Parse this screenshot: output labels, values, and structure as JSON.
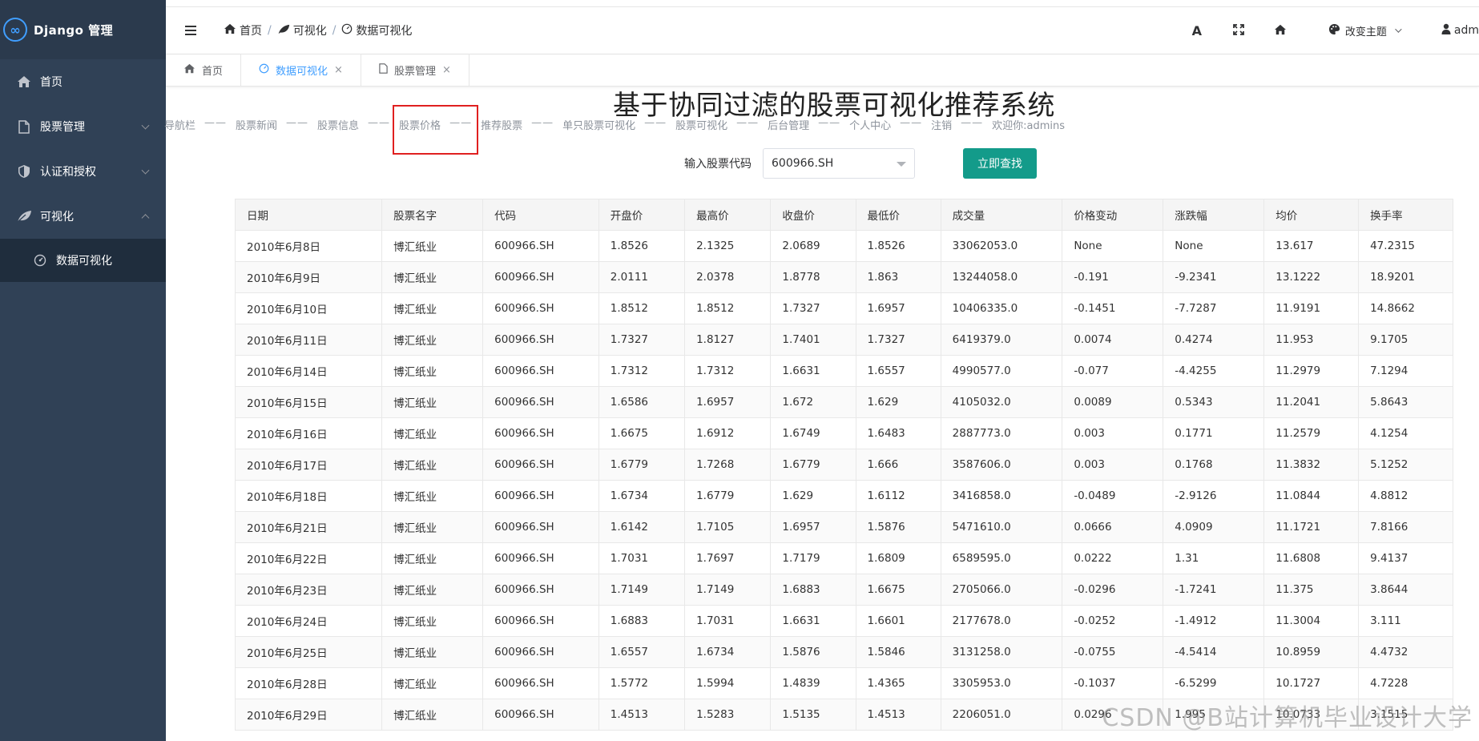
{
  "app": {
    "logo_glyph": "∞",
    "title": "Django 管理"
  },
  "sidebar": {
    "items": [
      {
        "label": "首页",
        "icon": "home-icon"
      },
      {
        "label": "股票管理",
        "icon": "document-icon"
      },
      {
        "label": "认证和授权",
        "icon": "shield-icon"
      },
      {
        "label": "可视化",
        "icon": "leaf-icon"
      }
    ],
    "submenu": [
      {
        "label": "数据可视化",
        "icon": "dashboard-icon"
      }
    ]
  },
  "breadcrumb": [
    "首页",
    "可视化",
    "数据可视化"
  ],
  "navbar": {
    "theme_label": "改变主题",
    "user_label": "adm"
  },
  "tags": [
    {
      "label": "首页",
      "active": false,
      "closable": false
    },
    {
      "label": "数据可视化",
      "active": true,
      "closable": true
    },
    {
      "label": "股票管理",
      "active": false,
      "closable": true
    }
  ],
  "main": {
    "title": "基于协同过滤的股票可视化推荐系统",
    "nav": [
      "导航栏",
      "股票新闻",
      "股票信息",
      "股票价格",
      "推荐股票",
      "单只股票可视化",
      "股票可视化",
      "后台管理",
      "个人中心",
      "注销",
      "欢迎你:admins"
    ],
    "nav_separator": "——",
    "search": {
      "label": "输入股票代码",
      "value": "600966.SH",
      "button": "立即查找"
    },
    "table": {
      "headers": [
        "日期",
        "股票名字",
        "代码",
        "开盘价",
        "最高价",
        "收盘价",
        "最低价",
        "成交量",
        "价格变动",
        "涨跌幅",
        "均价",
        "换手率"
      ],
      "rows": [
        [
          "2010年6月8日",
          "博汇纸业",
          "600966.SH",
          "1.8526",
          "2.1325",
          "2.0689",
          "1.8526",
          "33062053.0",
          "None",
          "None",
          "13.617",
          "47.2315"
        ],
        [
          "2010年6月9日",
          "博汇纸业",
          "600966.SH",
          "2.0111",
          "2.0378",
          "1.8778",
          "1.863",
          "13244058.0",
          "-0.191",
          "-9.2341",
          "13.1222",
          "18.9201"
        ],
        [
          "2010年6月10日",
          "博汇纸业",
          "600966.SH",
          "1.8512",
          "1.8512",
          "1.7327",
          "1.6957",
          "10406335.0",
          "-0.1451",
          "-7.7287",
          "11.9191",
          "14.8662"
        ],
        [
          "2010年6月11日",
          "博汇纸业",
          "600966.SH",
          "1.7327",
          "1.8127",
          "1.7401",
          "1.7327",
          "6419379.0",
          "0.0074",
          "0.4274",
          "11.953",
          "9.1705"
        ],
        [
          "2010年6月14日",
          "博汇纸业",
          "600966.SH",
          "1.7312",
          "1.7312",
          "1.6631",
          "1.6557",
          "4990577.0",
          "-0.077",
          "-4.4255",
          "11.2979",
          "7.1294"
        ],
        [
          "2010年6月15日",
          "博汇纸业",
          "600966.SH",
          "1.6586",
          "1.6957",
          "1.672",
          "1.629",
          "4105032.0",
          "0.0089",
          "0.5343",
          "11.2041",
          "5.8643"
        ],
        [
          "2010年6月16日",
          "博汇纸业",
          "600966.SH",
          "1.6675",
          "1.6912",
          "1.6749",
          "1.6483",
          "2887773.0",
          "0.003",
          "0.1771",
          "11.2579",
          "4.1254"
        ],
        [
          "2010年6月17日",
          "博汇纸业",
          "600966.SH",
          "1.6779",
          "1.7268",
          "1.6779",
          "1.666",
          "3587606.0",
          "0.003",
          "0.1768",
          "11.3832",
          "5.1252"
        ],
        [
          "2010年6月18日",
          "博汇纸业",
          "600966.SH",
          "1.6734",
          "1.6779",
          "1.629",
          "1.6112",
          "3416858.0",
          "-0.0489",
          "-2.9126",
          "11.0844",
          "4.8812"
        ],
        [
          "2010年6月21日",
          "博汇纸业",
          "600966.SH",
          "1.6142",
          "1.7105",
          "1.6957",
          "1.5876",
          "5471610.0",
          "0.0666",
          "4.0909",
          "11.1721",
          "7.8166"
        ],
        [
          "2010年6月22日",
          "博汇纸业",
          "600966.SH",
          "1.7031",
          "1.7697",
          "1.7179",
          "1.6809",
          "6589595.0",
          "0.0222",
          "1.31",
          "11.6808",
          "9.4137"
        ],
        [
          "2010年6月23日",
          "博汇纸业",
          "600966.SH",
          "1.7149",
          "1.7149",
          "1.6883",
          "1.6675",
          "2705066.0",
          "-0.0296",
          "-1.7241",
          "11.375",
          "3.8644"
        ],
        [
          "2010年6月24日",
          "博汇纸业",
          "600966.SH",
          "1.6883",
          "1.7031",
          "1.6631",
          "1.6601",
          "2177678.0",
          "-0.0252",
          "-1.4912",
          "11.3004",
          "3.111"
        ],
        [
          "2010年6月25日",
          "博汇纸业",
          "600966.SH",
          "1.6557",
          "1.6734",
          "1.5876",
          "1.5846",
          "3131258.0",
          "-0.0755",
          "-4.5414",
          "10.8959",
          "4.4732"
        ],
        [
          "2010年6月28日",
          "博汇纸业",
          "600966.SH",
          "1.5772",
          "1.5994",
          "1.4839",
          "1.4365",
          "3305953.0",
          "-0.1037",
          "-6.5299",
          "10.1727",
          "4.7228"
        ],
        [
          "2010年6月29日",
          "博汇纸业",
          "600966.SH",
          "1.4513",
          "1.5283",
          "1.5135",
          "1.4513",
          "2206051.0",
          "0.0296",
          "1.995",
          "10.0733",
          "3.1515"
        ]
      ]
    }
  },
  "watermark": "CSDN @B站计算机毕业设计大学"
}
